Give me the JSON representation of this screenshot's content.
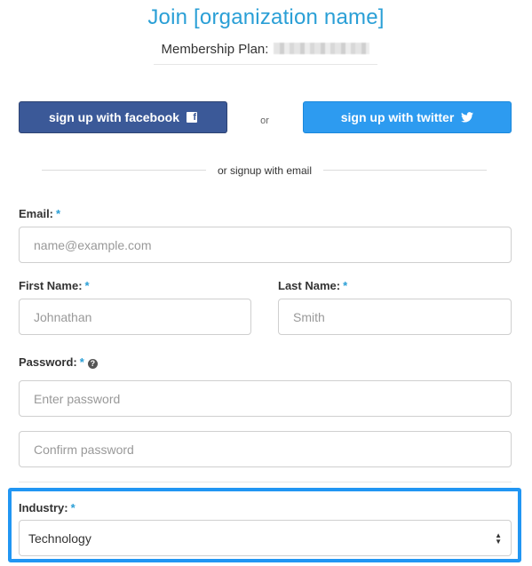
{
  "header": {
    "title": "Join [organization name]",
    "plan_label": "Membership Plan:"
  },
  "social": {
    "facebook_label": "sign up with facebook",
    "or_label": "or",
    "twitter_label": "sign up with twitter"
  },
  "divider": {
    "label": "or signup with email"
  },
  "form": {
    "required_mark": "*",
    "email": {
      "label": "Email:",
      "placeholder": "name@example.com"
    },
    "first_name": {
      "label": "First Name:",
      "placeholder": "Johnathan"
    },
    "last_name": {
      "label": "Last Name:",
      "placeholder": "Smith"
    },
    "password": {
      "label": "Password:",
      "placeholder": "Enter password",
      "confirm_placeholder": "Confirm password"
    },
    "industry": {
      "label": "Industry:",
      "value": "Technology"
    }
  },
  "colors": {
    "accent": "#2a9fd6",
    "facebook": "#3b5998",
    "twitter": "#2d9bf0",
    "highlight": "#2196f3"
  },
  "icons": [
    "facebook-icon",
    "twitter-icon",
    "help-icon",
    "select-arrows-icon"
  ]
}
